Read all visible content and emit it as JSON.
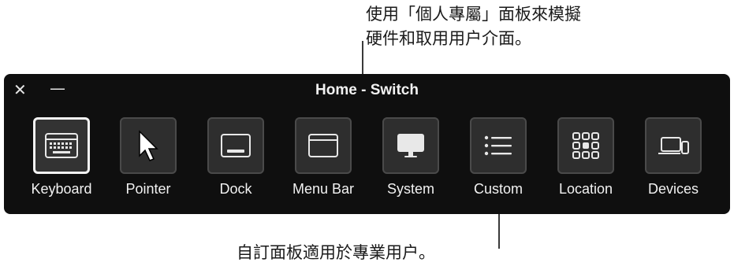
{
  "callouts": {
    "top": "使用「個人專屬」面板來模擬\n硬件和取用用户介面。",
    "bottom": "自訂面板適用於專業用户。"
  },
  "panel": {
    "title": "Home - Switch",
    "close_glyph": "✕",
    "minimize_glyph": "—",
    "items": [
      {
        "label": "Keyboard",
        "icon": "keyboard-icon",
        "selected": true
      },
      {
        "label": "Pointer",
        "icon": "pointer-icon"
      },
      {
        "label": "Dock",
        "icon": "dock-icon"
      },
      {
        "label": "Menu Bar",
        "icon": "menu-bar-icon"
      },
      {
        "label": "System",
        "icon": "system-icon"
      },
      {
        "label": "Custom",
        "icon": "custom-list-icon"
      },
      {
        "label": "Location",
        "icon": "location-grid-icon"
      },
      {
        "label": "Devices",
        "icon": "devices-icon"
      }
    ]
  },
  "colors": {
    "panel_bg": "#0f0f0f",
    "tile_bg": "#2e2e2e",
    "text": "#f2f2f2"
  }
}
